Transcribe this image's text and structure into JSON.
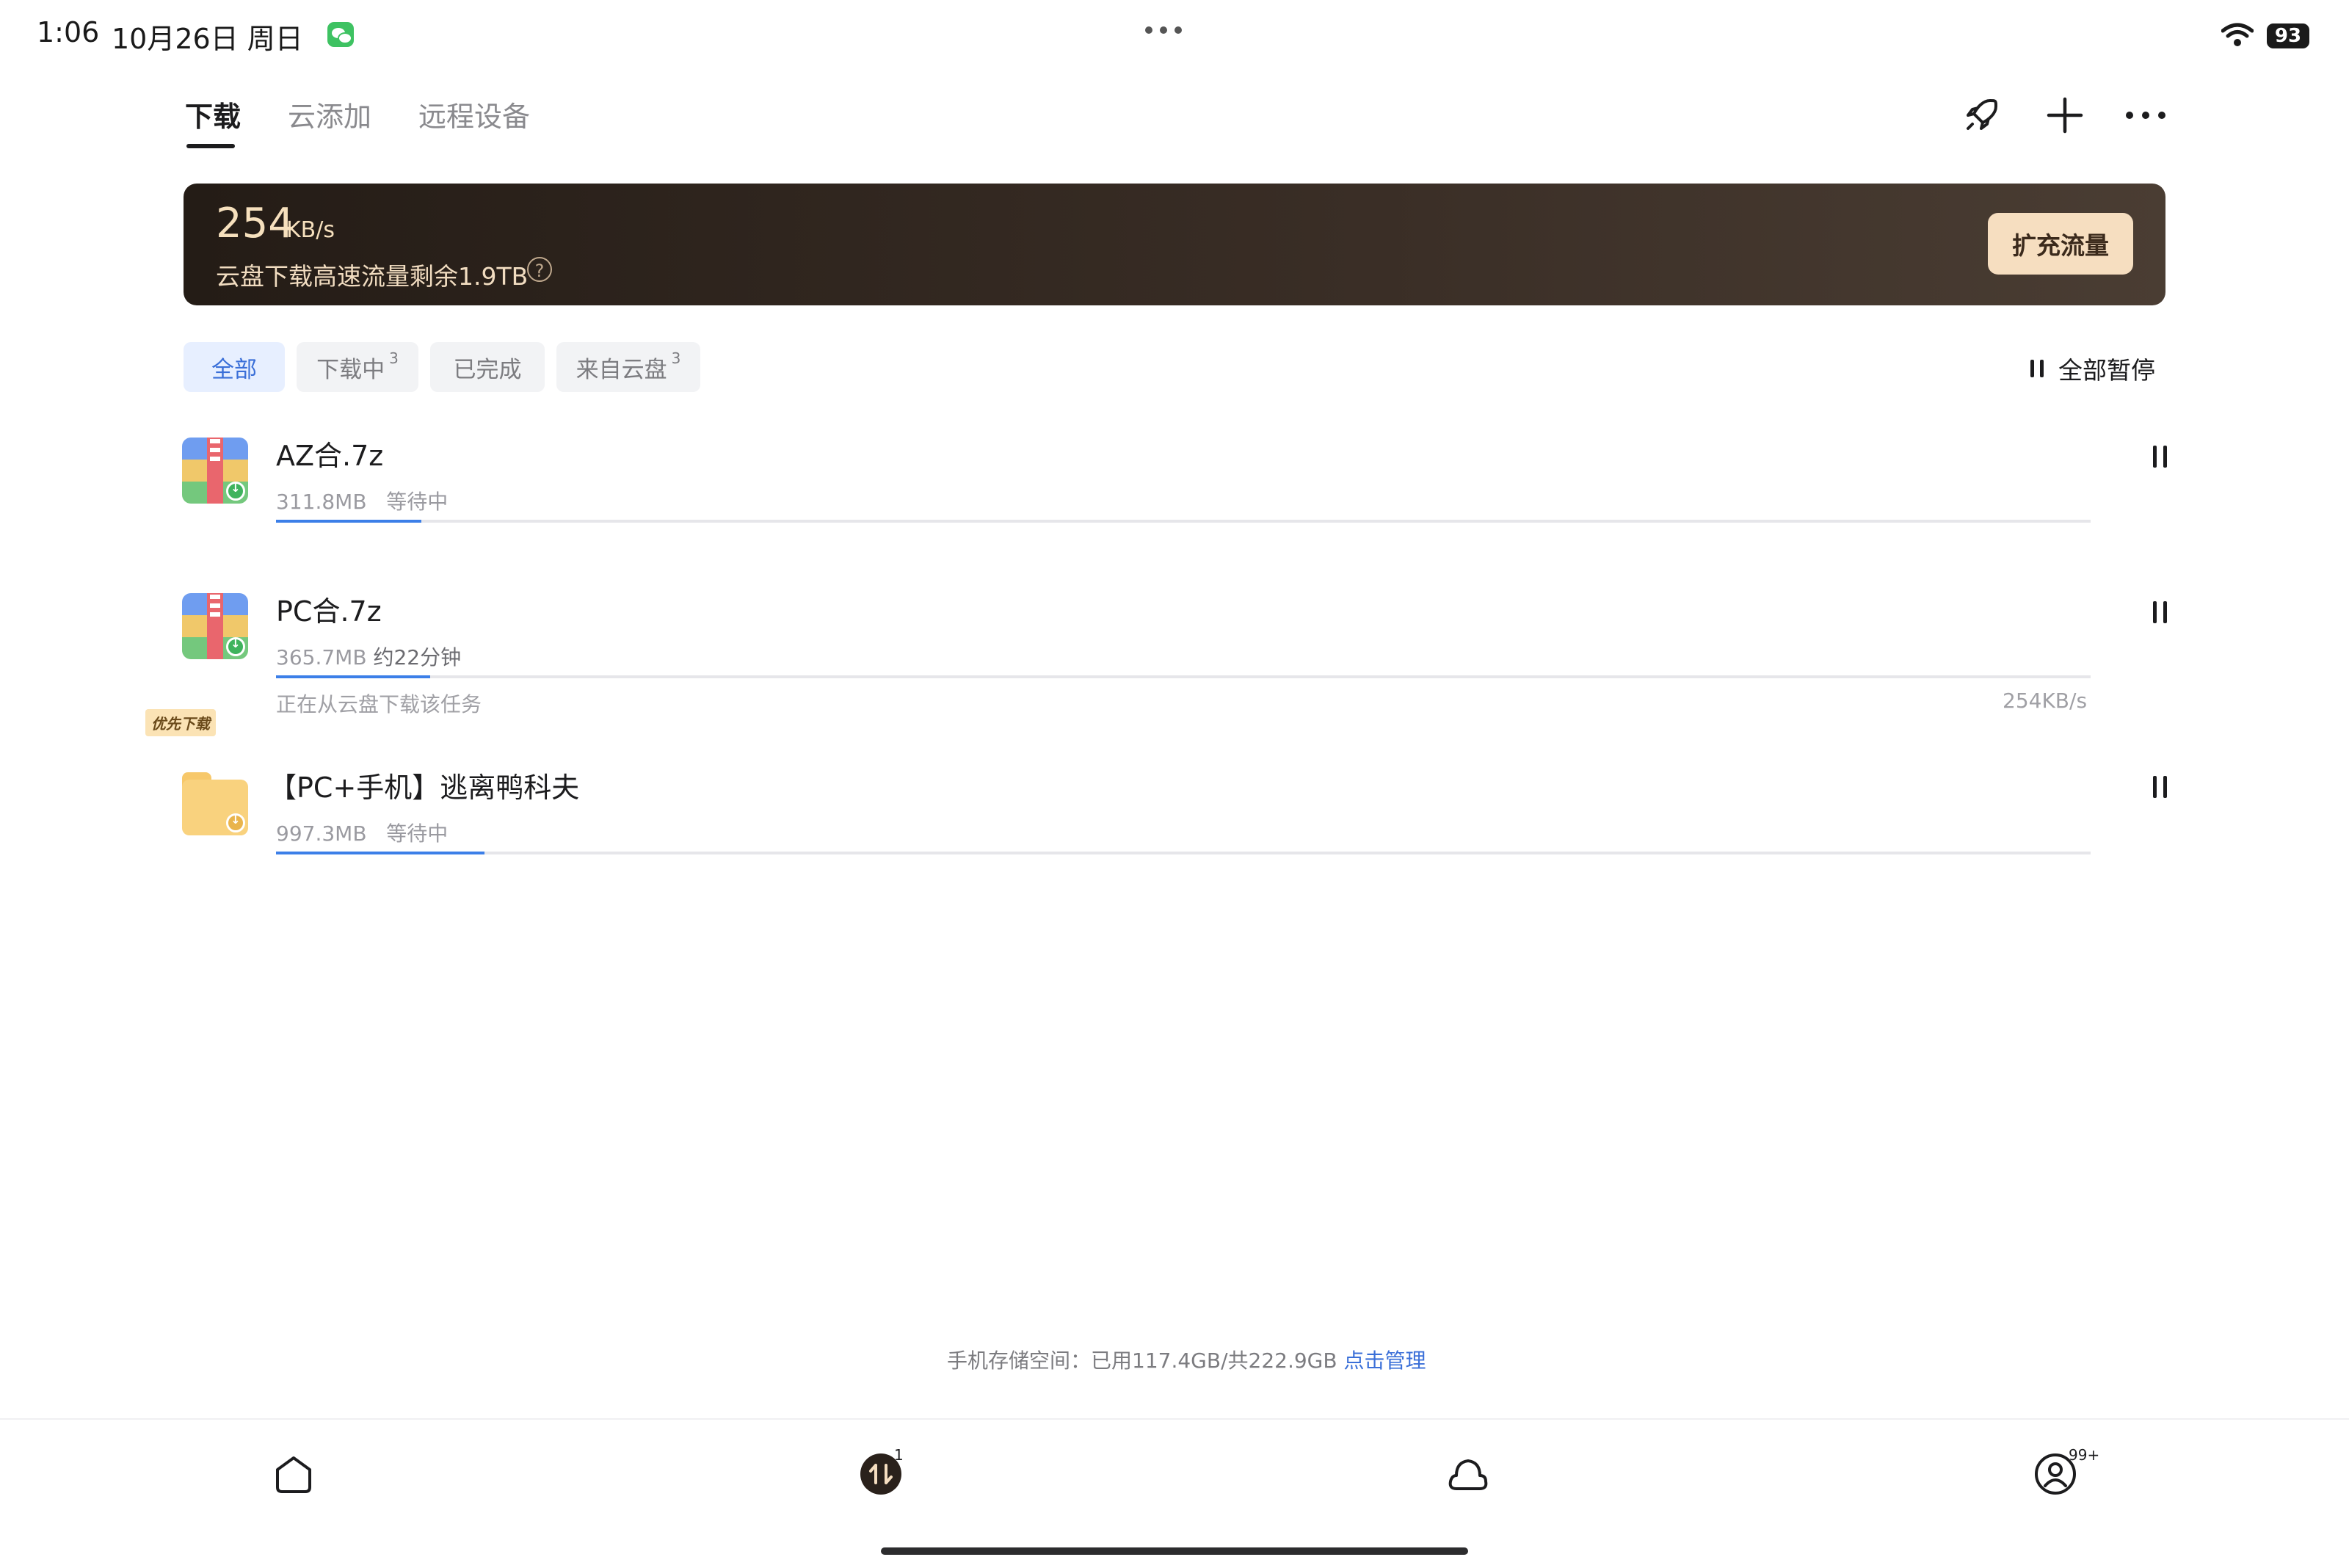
{
  "status_bar": {
    "time": "1:06",
    "date": "10月26日 周日",
    "battery": "93"
  },
  "tabs": [
    {
      "label": "下载",
      "active": true
    },
    {
      "label": "云添加",
      "active": false
    },
    {
      "label": "远程设备",
      "active": false
    }
  ],
  "toolbar": {
    "icons": [
      "rocket-icon",
      "add-icon",
      "more-icon"
    ]
  },
  "banner": {
    "speed_value": "254",
    "speed_unit": "KB/s",
    "quota_text": "云盘下载高速流量剩余1.9TB",
    "help_symbol": "?",
    "expand_label": "扩充流量"
  },
  "filters": [
    {
      "label": "全部",
      "count": "",
      "active": true
    },
    {
      "label": "下载中",
      "count": "3",
      "active": false
    },
    {
      "label": "已完成",
      "count": "",
      "active": false
    },
    {
      "label": "来自云盘",
      "count": "3",
      "active": false
    }
  ],
  "pause_all_label": "全部暂停",
  "downloads": [
    {
      "name": "AZ合.7z",
      "size": "311.8MB",
      "status": "等待中",
      "progress": 0.08
    },
    {
      "name": "PC合.7z",
      "size": "365.7MB",
      "status": "约22分钟",
      "progress": 0.085,
      "note": "正在从云盘下载该任务",
      "speed": "254KB/s"
    },
    {
      "name": "【PC+手机】逃离鸭科夫",
      "size": "997.3MB",
      "status": "等待中",
      "progress": 0.115,
      "badge": "优先下载"
    }
  ],
  "storage": {
    "text": "手机存储空间：已用117.4GB/共222.9GB",
    "manage_label": "点击管理"
  },
  "bottom_nav": {
    "transfer_badge": "1",
    "profile_badge": "99+"
  },
  "colors": {
    "accent": "#3a6fd8",
    "banner_dark": "#241c16",
    "banner_gold": "#f6dec0",
    "progress": "#3c7fe8"
  }
}
